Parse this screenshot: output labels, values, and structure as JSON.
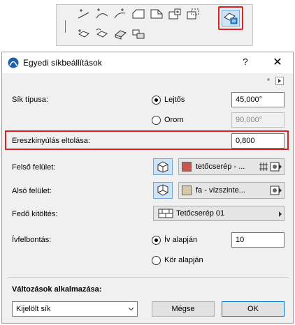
{
  "toolbar": {
    "tools": [
      "roof-segment-icon",
      "roof-arc-icon",
      "roof-curve-icon",
      "roof-shape-icon",
      "roof-polygon-icon",
      "roof-add-icon",
      "roof-dashed-icon",
      "roof-move-icon",
      "roof-rotate-icon",
      "roof-plane-icon",
      "roof-stack-icon"
    ],
    "selected_tool": "plane-settings-icon"
  },
  "dialog": {
    "title": "Egyedi síkbeállítások",
    "help": "?",
    "close": "✕",
    "degree_unit": "°",
    "plane_type": {
      "label": "Sík típusa:",
      "option_slope": "Lejtős",
      "option_gable": "Orom",
      "slope_value": "45,000°",
      "gable_value": "90,000°",
      "selected": "Lejtős"
    },
    "eave_offset": {
      "label": "Ereszkinyúlás eltolása:",
      "value": "0,800"
    },
    "top_surface": {
      "label": "Felső felület:",
      "material": "tetőcserép - ...",
      "color": "#c8584e"
    },
    "bottom_surface": {
      "label": "Alsó felület:",
      "material": "fa - vízszinte...",
      "color": "#d8c8a8"
    },
    "cover_fill": {
      "label": "Fedő kitöltés:",
      "value": "Tetőcserép 01"
    },
    "arc_resolution": {
      "label": "Ívfelbontás:",
      "option_arc": "Ív alapján",
      "option_circle": "Kör alapján",
      "arc_value": "10",
      "selected": "Ív alapján"
    },
    "apply_changes": {
      "label": "Változások alkalmazása:",
      "selected": "Kijelölt sík"
    },
    "cancel_label": "Mégse",
    "ok_label": "OK"
  },
  "colors": {
    "highlight": "#e02020",
    "selected_bg": "#cfe3f7",
    "selected_border": "#6ea7d8"
  }
}
